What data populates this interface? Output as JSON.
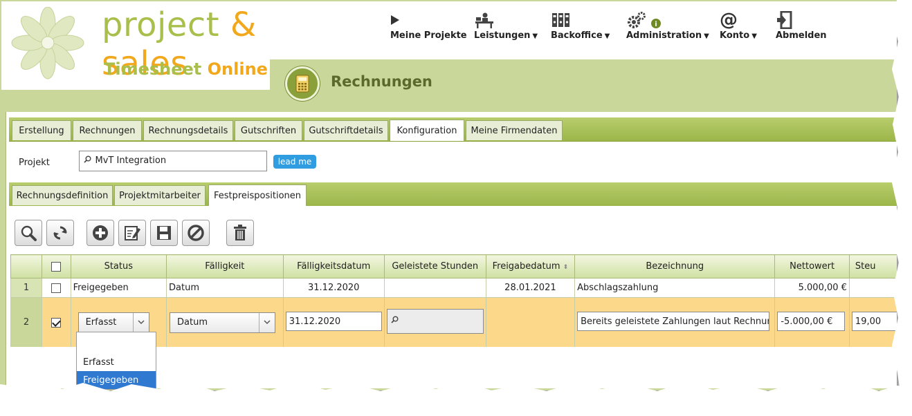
{
  "brand": {
    "project": "project",
    "amp": "&",
    "sales": "sales",
    "timesheet": "Timesheet",
    "online": "Online"
  },
  "nav": [
    {
      "label": "Meine Projekte",
      "icon": "play-icon",
      "has_menu": false
    },
    {
      "label": "Leistungen",
      "icon": "desk-icon",
      "has_menu": true
    },
    {
      "label": "Backoffice",
      "icon": "binders-icon",
      "has_menu": true
    },
    {
      "label": "Administration",
      "icon": "gears-icon",
      "has_menu": true,
      "badge": "i"
    },
    {
      "label": "Konto",
      "icon": "at-icon",
      "has_menu": true
    },
    {
      "label": "Abmelden",
      "icon": "logout-icon",
      "has_menu": false
    }
  ],
  "page_title": "Rechnungen",
  "tabs": [
    "Erstellung",
    "Rechnungen",
    "Rechnungsdetails",
    "Gutschriften",
    "Gutschriftdetails",
    "Konfiguration",
    "Meine Firmendaten"
  ],
  "active_tab": "Konfiguration",
  "project": {
    "label": "Projekt",
    "value": "MvT Integration",
    "lead_button": "lead me"
  },
  "subtabs": [
    "Rechnungsdefinition",
    "Projektmitarbeiter",
    "Festpreispositionen"
  ],
  "active_subtab": "Festpreispositionen",
  "toolbar": [
    "search-icon",
    "refresh-icon",
    "add-icon",
    "edit-icon",
    "save-icon",
    "cancel-icon",
    "delete-icon"
  ],
  "grid": {
    "columns": [
      "Status",
      "Fälligkeit",
      "Fälligkeitsdatum",
      "Geleistete Stunden",
      "Freigabedatum",
      "Bezeichnung",
      "Nettowert",
      "Steu"
    ],
    "rows": [
      {
        "num": "1",
        "checked": false,
        "status": "Freigegeben",
        "faelligkeit": "Datum",
        "faelligkeitsdatum": "31.12.2020",
        "stunden": "",
        "freigabedatum": "28.01.2021",
        "bezeichnung": "Abschlagszahlung",
        "nettowert": "5.000,00 €",
        "steuer": ""
      },
      {
        "num": "2",
        "checked": true,
        "status": "Erfasst",
        "faelligkeit": "Datum",
        "faelligkeitsdatum": "31.12.2020",
        "stunden": "",
        "freigabedatum": "",
        "bezeichnung": "Bereits geleistete Zahlungen laut Rechnungs",
        "nettowert": "-5.000,00 €",
        "steuer": "19,00"
      }
    ]
  },
  "status_dropdown": {
    "options": [
      "",
      "Erfasst",
      "Freigegeben"
    ],
    "highlighted": "Freigegeben"
  },
  "colors": {
    "brand_green": "#a9bf4c",
    "brand_orange": "#f2a81d",
    "band_green": "#c9d79a",
    "edit_row": "#fcd98a",
    "lead_button": "#2f9de0",
    "selection_blue": "#2f79d0"
  }
}
